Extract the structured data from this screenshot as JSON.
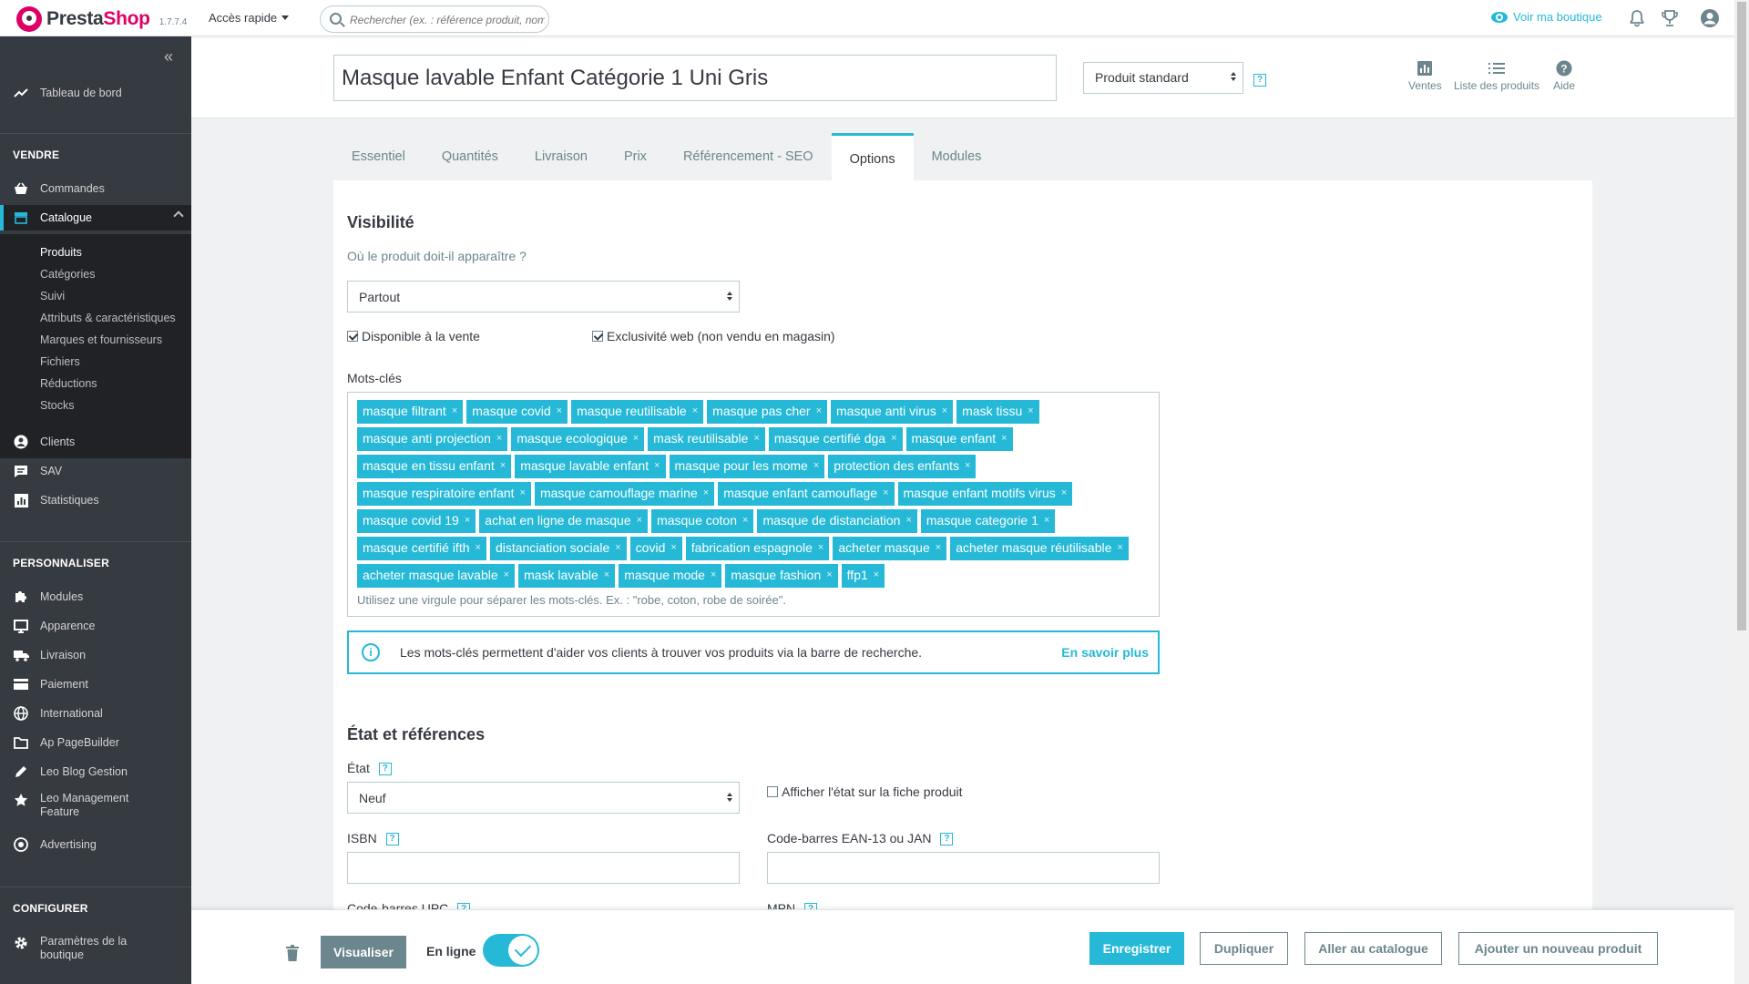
{
  "header": {
    "brand_pre": "Presta",
    "brand_post": "Shop",
    "version": "1.7.7.4",
    "quick_access": "Accès rapide",
    "search_placeholder": "Rechercher (ex. : référence produit, nom",
    "view_shop": "Voir ma boutique",
    "icons": [
      "bell-icon",
      "trophy-icon",
      "account-icon"
    ]
  },
  "sidebar": {
    "dashboard": "Tableau de bord",
    "section_sell": "VENDRE",
    "orders": "Commandes",
    "catalog": "Catalogue",
    "catalog_sub": [
      "Produits",
      "Catégories",
      "Suivi",
      "Attributs & caractéristiques",
      "Marques et fournisseurs",
      "Fichiers",
      "Réductions",
      "Stocks"
    ],
    "customers": "Clients",
    "sav": "SAV",
    "stats": "Statistiques",
    "section_customize": "PERSONNALISER",
    "customize_items": [
      "Modules",
      "Apparence",
      "Livraison",
      "Paiement",
      "International",
      "Ap PageBuilder",
      "Leo Blog Gestion"
    ],
    "leo_mgmt_1": "Leo Management",
    "leo_mgmt_2": "Feature",
    "advertising": "Advertising",
    "section_configure": "CONFIGURER",
    "params_1": "Paramètres de la",
    "params_2": "boutique"
  },
  "product": {
    "name": "Masque lavable Enfant Catégorie 1 Uni Gris",
    "type": "Produit standard"
  },
  "toolbar": {
    "sales": "Ventes",
    "product_list": "Liste des produits",
    "help": "Aide"
  },
  "tabs": [
    "Essentiel",
    "Quantités",
    "Livraison",
    "Prix",
    "Référencement - SEO",
    "Options",
    "Modules"
  ],
  "active_tab": "Options",
  "visibility": {
    "title": "Visibilité",
    "question": "Où le produit doit-il apparaître ?",
    "value": "Partout",
    "available_for_sale": "Disponible à la vente",
    "web_exclusive": "Exclusivité web (non vendu en magasin)"
  },
  "keywords": {
    "label": "Mots-clés",
    "tags": [
      "masque filtrant",
      "masque covid",
      "masque reutilisable",
      "masque pas cher",
      "masque anti virus",
      "mask tissu",
      "masque anti projection",
      "masque ecologique",
      "mask reutilisable",
      "masque certifié dga",
      "masque enfant",
      "masque en tissu enfant",
      "masque lavable enfant",
      "masque pour les mome",
      "protection des enfants",
      "masque respiratoire enfant",
      "masque camouflage marine",
      "masque enfant camouflage",
      "masque enfant motifs virus",
      "masque covid 19",
      "achat en ligne de masque",
      "masque coton",
      "masque de distanciation",
      "masque categorie 1",
      "masque certifié ifth",
      "distanciation sociale",
      "covid",
      "fabrication espagnole",
      "acheter masque",
      "acheter masque réutilisable",
      "acheter masque lavable",
      "mask lavable",
      "masque mode",
      "masque fashion",
      "ffp1"
    ],
    "hint": "Utilisez une virgule pour séparer les mots-clés. Ex. : \"robe, coton, robe de soirée\".",
    "info": "Les mots-clés permettent d'aider vos clients à trouver vos produits via la barre de recherche.",
    "learn_more": "En savoir plus"
  },
  "state": {
    "title": "État et références",
    "condition_label": "État",
    "condition_value": "Neuf",
    "show_condition": "Afficher l'état sur la fiche produit",
    "isbn": "ISBN",
    "ean": "Code-barres EAN-13 ou JAN",
    "upc": "Code-barres UPC",
    "mpn": "MPN"
  },
  "footer": {
    "preview": "Visualiser",
    "online": "En ligne",
    "save": "Enregistrer",
    "duplicate": "Dupliquer",
    "go_catalog": "Aller au catalogue",
    "add_new": "Ajouter un nouveau produit"
  },
  "colors": {
    "accent": "#25b9d7",
    "brand": "#df0067",
    "sidebar": "#363a41"
  }
}
